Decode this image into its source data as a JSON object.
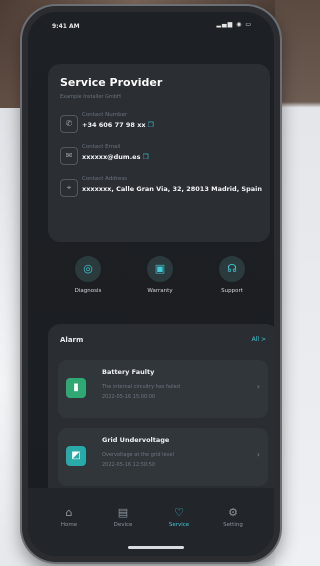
{
  "status_bar": {
    "time": "9:41 AM",
    "icons": "▂▄▆ ◉ ▭"
  },
  "provider": {
    "title": "Service Provider",
    "subtitle": "Example Installer GmbH",
    "rows": [
      {
        "icon": "phone-icon",
        "glyph": "✆",
        "label": "Contact Number",
        "value": "+34 606 77 98 xx"
      },
      {
        "icon": "mail-icon",
        "glyph": "✉",
        "label": "Contact Email",
        "value": "xxxxxx@dum.es"
      },
      {
        "icon": "location-pin-icon",
        "glyph": "⌖",
        "label": "Contact Address",
        "value": "xxxxxxx, Calle Gran Via, 32, 28013 Madrid, Spain"
      }
    ],
    "copy_glyph": "❐"
  },
  "actions": [
    {
      "label": "Diagnosis",
      "glyph": "◎"
    },
    {
      "label": "Warranty",
      "glyph": "▣"
    },
    {
      "label": "Support",
      "glyph": "☊"
    }
  ],
  "alarm": {
    "title": "Alarm",
    "all_label": "All >",
    "items": [
      {
        "name": "Battery Faulty",
        "desc": "The internal circuitry has failed",
        "date": "2022-05-16 15:00:00",
        "icon_color": "#2fa873",
        "glyph": "▮"
      },
      {
        "name": "Grid Undervoltage",
        "desc": "Overvoltage at the grid level",
        "date": "2022-05-16 12:50:50",
        "icon_color": "#2aa9a9",
        "glyph": "◩"
      }
    ],
    "chevron": "›"
  },
  "tabbar": {
    "tabs": [
      {
        "label": "Home",
        "glyph": "⌂",
        "active": false
      },
      {
        "label": "Device",
        "glyph": "▤",
        "active": false
      },
      {
        "label": "Service",
        "glyph": "♡",
        "active": true
      },
      {
        "label": "Setting",
        "glyph": "⚙",
        "active": false
      }
    ]
  },
  "colors": {
    "accent": "#43c8d6",
    "card": "#2b2f34",
    "screen": "#1d2024"
  }
}
